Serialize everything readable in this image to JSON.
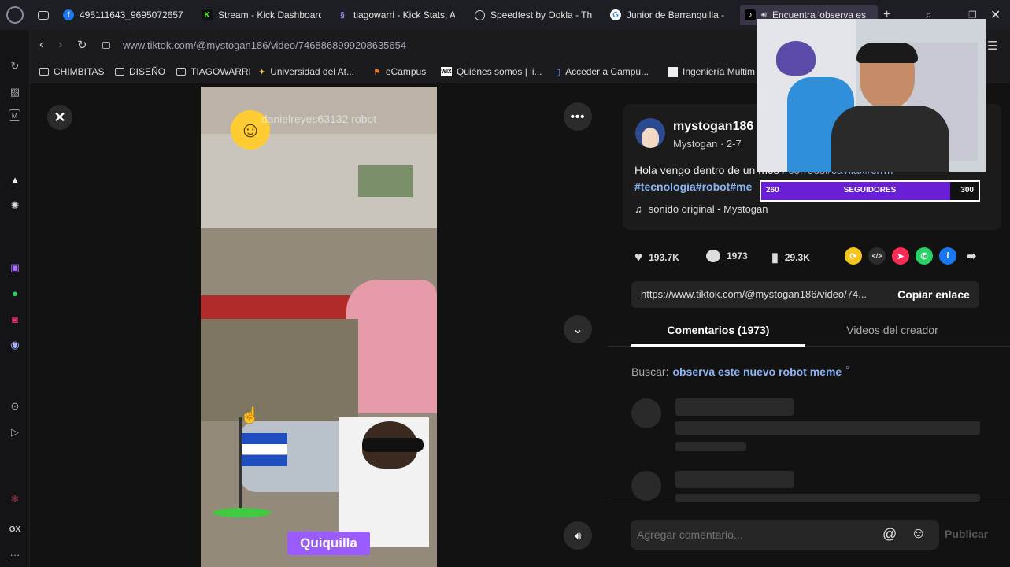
{
  "tabs": [
    {
      "label": "495111643_9695072657"
    },
    {
      "label": "Stream - Kick Dashboard"
    },
    {
      "label": "tiagowarri - Kick Stats, A"
    },
    {
      "label": "Speedtest by Ookla - Th"
    },
    {
      "label": "Junior de Barranquilla -"
    },
    {
      "label": "Encuentra 'observa es"
    }
  ],
  "address": {
    "url": "www.tiktok.com/@mystogan186/video/7468868999208635654"
  },
  "bookmarks": [
    {
      "label": "CHIMBITAS"
    },
    {
      "label": "DISEÑO"
    },
    {
      "label": "TIAGOWARRI"
    },
    {
      "label": "Universidad del At..."
    },
    {
      "label": "eCampus"
    },
    {
      "label": "Quiénes somos | li..."
    },
    {
      "label": "Acceder a Campu..."
    },
    {
      "label": "Ingeniería Multim"
    }
  ],
  "video": {
    "watermark": "danielreyes63132 robot",
    "overlay_text": "Quiquilla"
  },
  "author": {
    "handle": "mystogan186",
    "name_date": "Mystogan · 2-7",
    "caption_line1": "Hola vengo dentro de un mes ",
    "caption_tags1": "#correos#cavilax#crrm",
    "caption_tags2": "#tecnologia#robot#me",
    "sound": "sonido original - Mystogan"
  },
  "stats": {
    "likes": "193.7K",
    "comments": "1973",
    "saves": "29.3K"
  },
  "link": {
    "url": "https://www.tiktok.com/@mystogan186/video/74...",
    "copy_label": "Copiar enlace"
  },
  "panel_tabs": {
    "comments": "Comentarios (1973)",
    "creator_videos": "Videos del creador"
  },
  "search": {
    "prefix": "Buscar:",
    "query": "observa este nuevo robot meme"
  },
  "comment_input": {
    "placeholder": "Agregar comentario...",
    "publish": "Publicar"
  },
  "followers_goal": {
    "current": "260",
    "label": "SEGUIDORES",
    "target": "300",
    "progress": 0.87
  },
  "colors": {
    "accent_pink": "#fe2c55",
    "link_blue": "#8ab4f8",
    "goal_purple": "#6a1fd6"
  }
}
